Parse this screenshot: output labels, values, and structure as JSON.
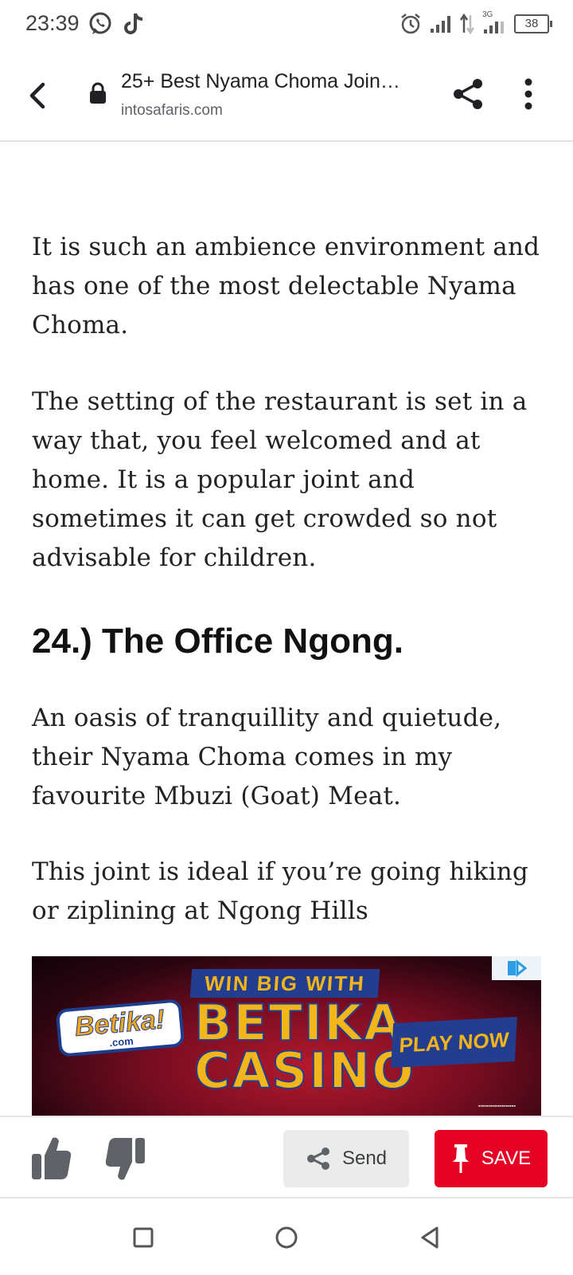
{
  "status_bar": {
    "time": "23:39",
    "network": "3G",
    "battery": "38",
    "app_icons": [
      "whatsapp-icon",
      "tiktok-icon"
    ],
    "system_icons": [
      "alarm-icon",
      "signal-icon",
      "data-arrows-icon",
      "signal-3g-icon",
      "battery-icon"
    ]
  },
  "browser": {
    "title": "25+ Best Nyama Choma Join…",
    "domain": "intosafaris.com"
  },
  "article": {
    "paragraph_1": "It is such an ambience environment and has one of the most delectable Nyama Choma.",
    "paragraph_2": "The setting of the restaurant is set in a way that, you feel welcomed and at home. It is a popular joint and sometimes it can get crowded so not advisable for children.",
    "heading": "24.) The Office Ngong.",
    "paragraph_3": "An oasis of tranquillity and quietude, their Nyama Choma comes in my favourite Mbuzi (Goat) Meat.",
    "paragraph_4": "This joint is ideal if you’re going hiking or ziplining at Ngong Hills"
  },
  "ad": {
    "logo_main": "Betika!",
    "logo_sub": ".com",
    "headline": "WIN BIG WITH",
    "brand_line_1": "BETIKA",
    "brand_line_2": "CASINO",
    "cta": "PLAY NOW",
    "colors": {
      "brand_blue": "#233d8f",
      "brand_yellow": "#f2b418",
      "background_red": "#b5192c"
    }
  },
  "action_bar": {
    "send_label": "Send",
    "save_label": "SAVE",
    "save_color": "#e60023"
  }
}
